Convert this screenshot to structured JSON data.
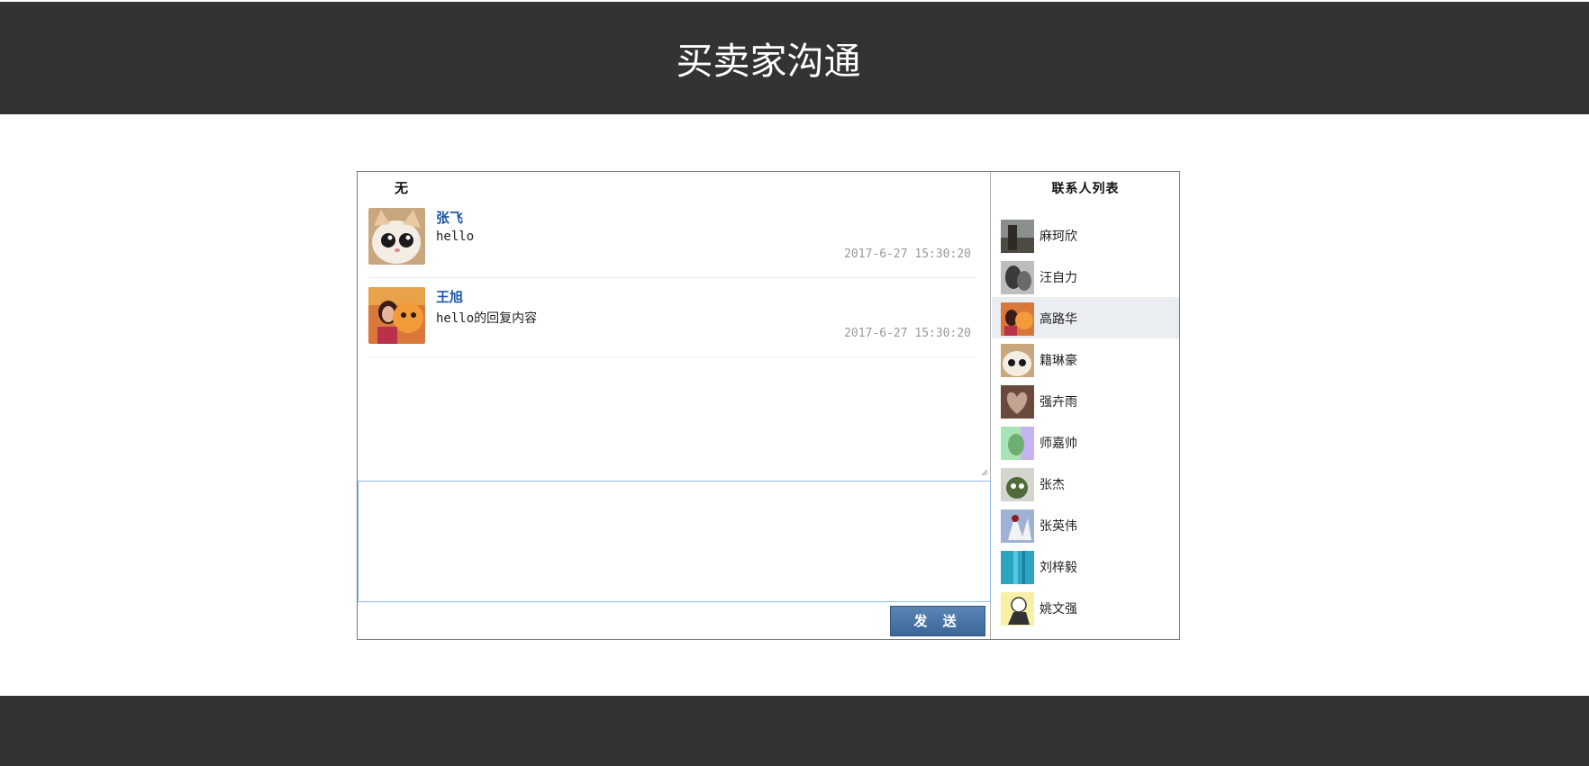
{
  "header": {
    "title": "买卖家沟通"
  },
  "chat": {
    "current_contact": "无",
    "messages": [
      {
        "name": "张飞",
        "text": "hello",
        "time": "2017-6-27 15:30:20"
      },
      {
        "name": "王旭",
        "text": "hello的回复内容",
        "time": "2017-6-27 15:30:20"
      }
    ],
    "input_value": "",
    "send_label": "发 送"
  },
  "contacts": {
    "title": "联系人列表",
    "items": [
      {
        "name": "麻珂欣"
      },
      {
        "name": "汪自力"
      },
      {
        "name": "高路华",
        "active": true
      },
      {
        "name": "籍琳豪"
      },
      {
        "name": "强卉雨"
      },
      {
        "name": "师嘉帅"
      },
      {
        "name": "张杰"
      },
      {
        "name": "张英伟"
      },
      {
        "name": "刘梓毅"
      },
      {
        "name": "姚文强"
      }
    ]
  },
  "colors": {
    "header_bg": "#333333",
    "name_link": "#1c57a4",
    "send_button": "#3b6799",
    "active_contact_bg": "#eaedf2"
  }
}
